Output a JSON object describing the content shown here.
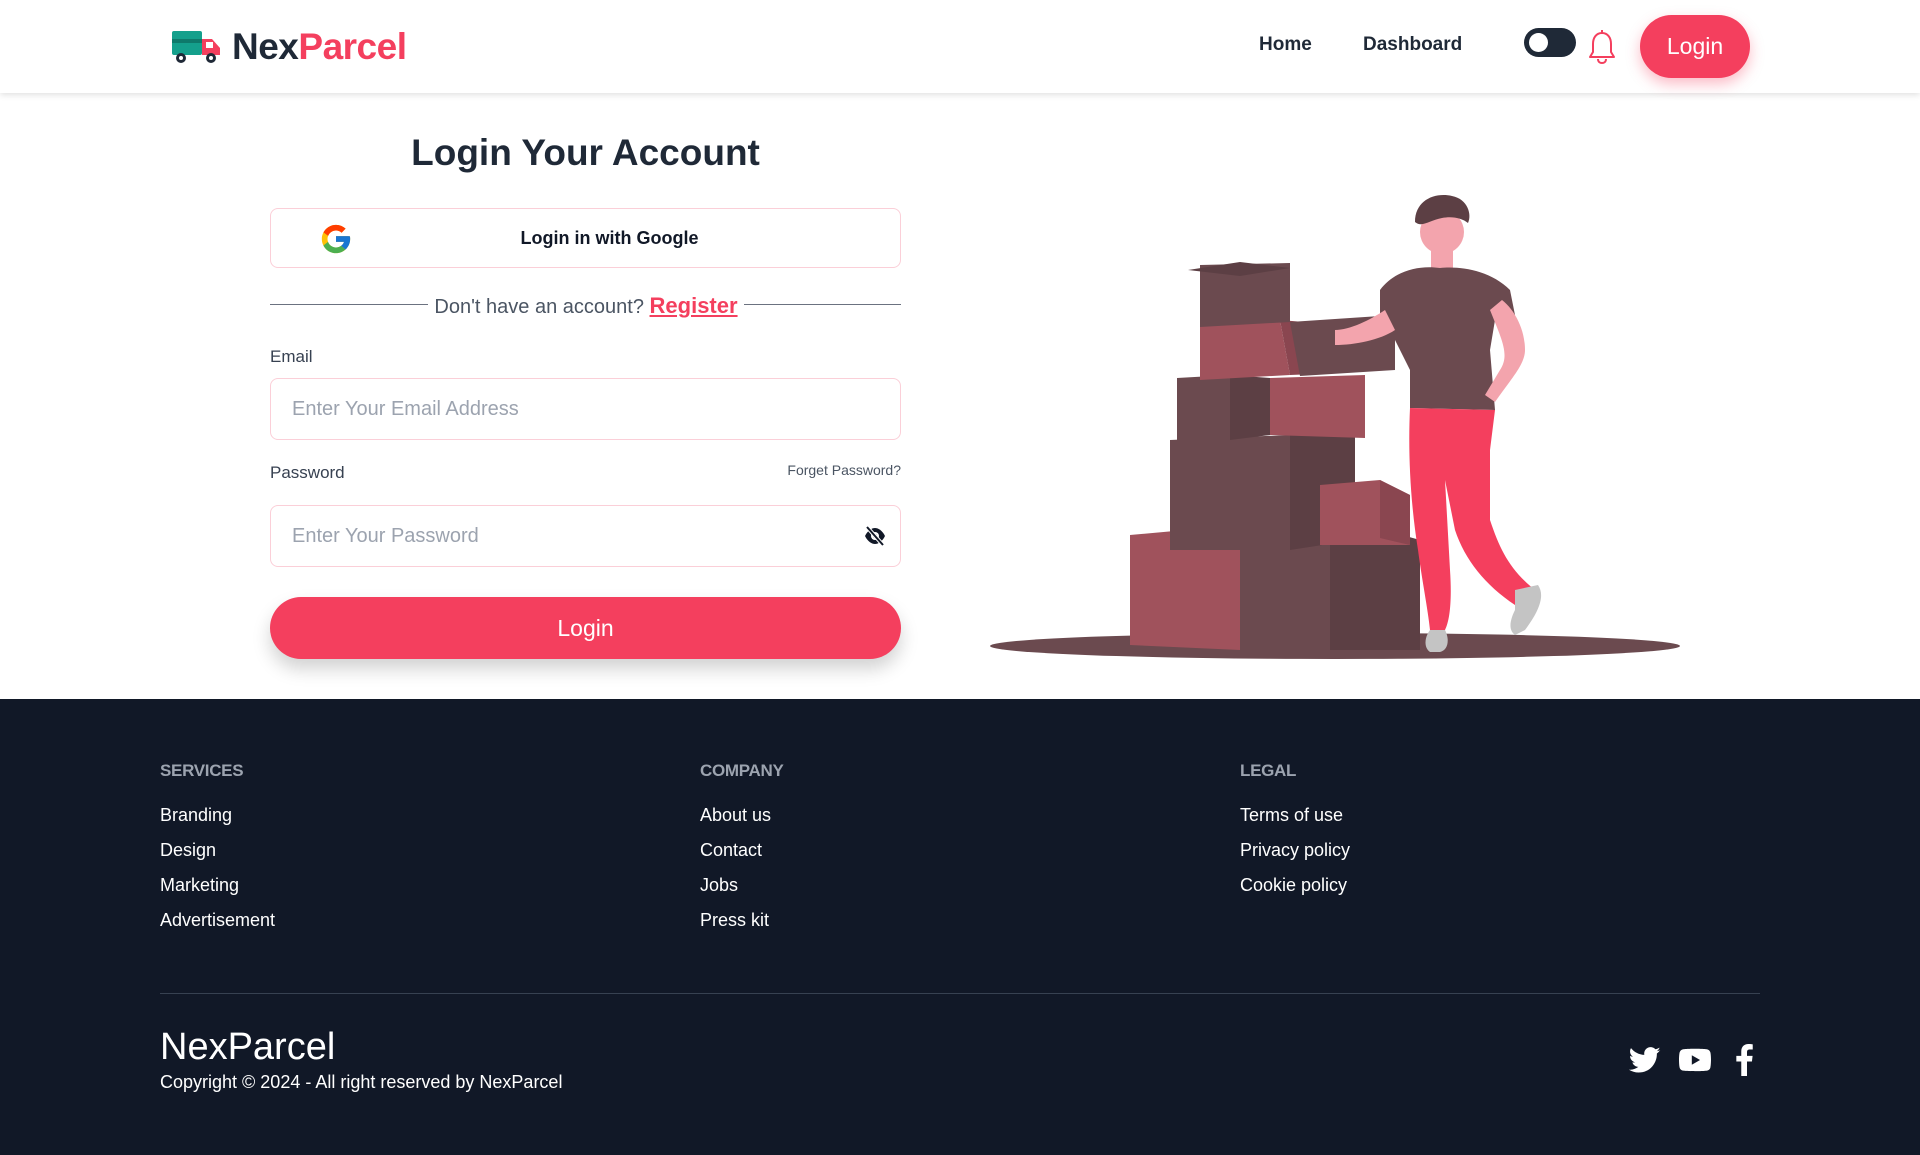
{
  "header": {
    "brand_part1": "Nex",
    "brand_part2": "Parcel",
    "nav": {
      "home": "Home",
      "dashboard": "Dashboard"
    },
    "login_button": "Login"
  },
  "login_form": {
    "title": "Login Your Account",
    "google_button": "Login in with Google",
    "no_account_text": "Don't have an account?",
    "register_link": "Register",
    "email_label": "Email",
    "email_placeholder": "Enter Your Email Address",
    "password_label": "Password",
    "forgot_password": "Forget Password?",
    "password_placeholder": "Enter Your Password",
    "submit_button": "Login"
  },
  "footer": {
    "services": {
      "heading": "SERVICES",
      "links": [
        "Branding",
        "Design",
        "Marketing",
        "Advertisement"
      ]
    },
    "company": {
      "heading": "COMPANY",
      "links": [
        "About us",
        "Contact",
        "Jobs",
        "Press kit"
      ]
    },
    "legal": {
      "heading": "LEGAL",
      "links": [
        "Terms of use",
        "Privacy policy",
        "Cookie policy"
      ]
    },
    "brand": "NexParcel",
    "copyright": "Copyright © 2024 - All right reserved by NexParcel",
    "social_icons": [
      "twitter-icon",
      "youtube-icon",
      "facebook-icon"
    ]
  },
  "colors": {
    "accent": "#f43f5e",
    "dark": "#1f2937",
    "footer_bg": "#111827",
    "box_dark": "#6b4a4f",
    "box_light": "#a0525c"
  }
}
